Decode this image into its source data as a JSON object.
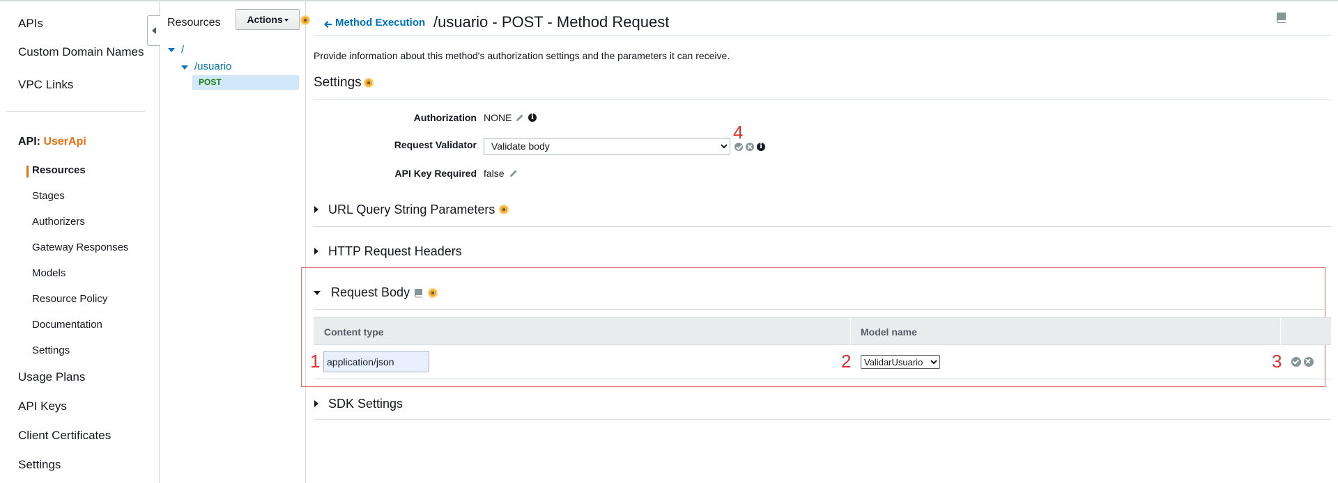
{
  "nav": {
    "top_items": [
      "APIs",
      "Custom Domain Names",
      "VPC Links"
    ],
    "api_prefix": "API: ",
    "api_name": "UserApi",
    "sub_items": [
      "Resources",
      "Stages",
      "Authorizers",
      "Gateway Responses",
      "Models",
      "Resource Policy",
      "Documentation",
      "Settings"
    ],
    "bottom_items": [
      "Usage Plans",
      "API Keys",
      "Client Certificates",
      "Settings"
    ]
  },
  "resources": {
    "title": "Resources",
    "actions_label": "Actions",
    "tree": {
      "root": "/",
      "child": "/usuario",
      "method": "POST"
    }
  },
  "main": {
    "back_link": "Method Execution",
    "title": "/usuario - POST - Method Request",
    "description": "Provide information about this method's authorization settings and the parameters it can receive.",
    "settings": {
      "heading": "Settings",
      "authorization_label": "Authorization",
      "authorization_value": "NONE",
      "validator_label": "Request Validator",
      "validator_value": "Validate body",
      "api_key_label": "API Key Required",
      "api_key_value": "false"
    },
    "sections": {
      "url_query": "URL Query String Parameters",
      "http_headers": "HTTP Request Headers",
      "request_body": "Request Body",
      "sdk_settings": "SDK Settings"
    },
    "body_table": {
      "columns": [
        "Content type",
        "Model name"
      ],
      "row": {
        "content_type": "application/json",
        "model_name": "ValidarUsuario"
      }
    },
    "annotations": [
      "1",
      "2",
      "3",
      "4"
    ]
  },
  "colors": {
    "accent": "#ec7211",
    "link": "#0073bb",
    "annotation": "#e02f2f",
    "post": "#1d8102"
  }
}
